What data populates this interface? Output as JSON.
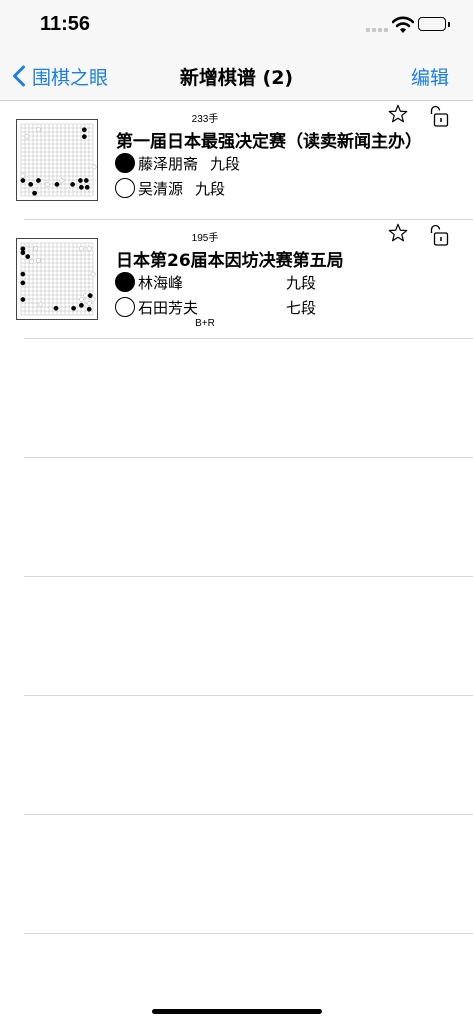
{
  "status": {
    "time": "11:56"
  },
  "nav": {
    "back_label": "围棋之眼",
    "title": "新增棋谱 (2)",
    "edit_label": "编辑"
  },
  "games": [
    {
      "moves": "233手",
      "title": "第一届日本最强决定赛（读卖新闻主办）",
      "black_player": "藤泽朋斋",
      "black_rank": "九段",
      "white_player": "吴清源",
      "white_rank": "九段",
      "result": ""
    },
    {
      "moves": "195手",
      "title": "日本第26届本因坊决赛第五局",
      "black_player": "林海峰",
      "black_rank": "九段",
      "white_player": "石田芳夫",
      "white_rank": "七段",
      "result": "B+R"
    }
  ]
}
